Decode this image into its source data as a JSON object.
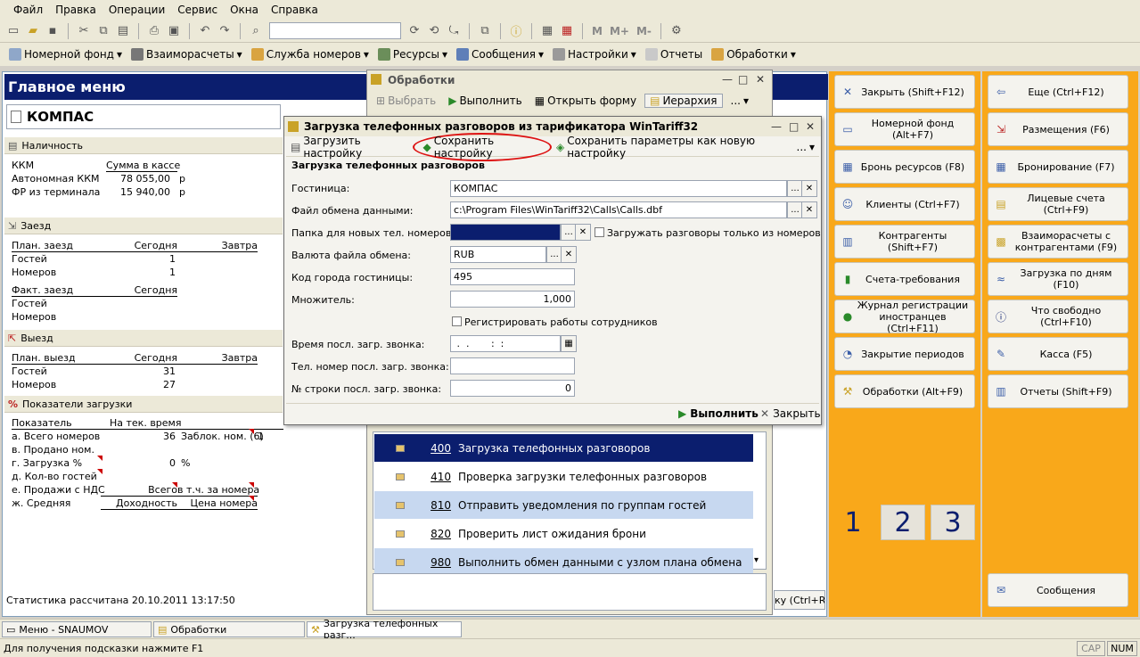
{
  "menubar": [
    "Файл",
    "Правка",
    "Операции",
    "Сервис",
    "Окна",
    "Справка"
  ],
  "toolbar2": [
    {
      "label": "Номерной фонд",
      "icon": "rooms-icon"
    },
    {
      "label": "Взаиморасчеты",
      "icon": "settlements-icon"
    },
    {
      "label": "Служба номеров",
      "icon": "room-service-icon"
    },
    {
      "label": "Ресурсы",
      "icon": "resources-icon"
    },
    {
      "label": "Сообщения",
      "icon": "messages-icon"
    },
    {
      "label": "Настройки",
      "icon": "settings-icon"
    },
    {
      "label": "Отчеты",
      "icon": "reports-icon"
    },
    {
      "label": "Обработки",
      "icon": "processing-icon"
    }
  ],
  "main_menu": {
    "title": "Главное меню",
    "company": "КОМПАС",
    "cash": {
      "header": "Наличность",
      "col1": "ККМ",
      "col2": "Сумма в кассе",
      "rows": [
        {
          "name": "Автономная ККМ",
          "value": "78 055,00",
          "unit": "р"
        },
        {
          "name": "ФР из терминала",
          "value": "15 940,00",
          "unit": "р"
        }
      ]
    },
    "checkin": {
      "header": "Заезд",
      "plan_label": "План. заезд",
      "today": "Сегодня",
      "tomorrow": "Завтра",
      "guests_label": "Гостей",
      "guests_today": "1",
      "rooms_label": "Номеров",
      "rooms_today": "1",
      "fact_label": "Факт. заезд",
      "fact_today": "Сегодня",
      "fact_guests": "Гостей",
      "fact_rooms": "Номеров"
    },
    "checkout": {
      "header": "Выезд",
      "plan_label": "План. выезд",
      "today": "Сегодня",
      "tomorrow": "Завтра",
      "guests_label": "Гостей",
      "guests_today": "31",
      "rooms_label": "Номеров",
      "rooms_today": "27"
    },
    "load": {
      "header": "Показатели загрузки",
      "col1": "Показатель",
      "col2": "На тек. время",
      "rows": [
        {
          "name": "а. Всего номеров",
          "value": "36",
          "extra": "Заблок. ном. (6)",
          "extra_value": "1"
        },
        {
          "name": "в. Продано ном.",
          "value": "",
          "extra": "",
          "extra_value": ""
        },
        {
          "name": "г. Загрузка %",
          "value": "0",
          "extra": "%",
          "extra_value": ""
        },
        {
          "name": "д. Кол-во гостей",
          "value": "",
          "extra": "",
          "extra_value": ""
        },
        {
          "name": "е. Продажи с НДС",
          "value": "Всего",
          "extra": "в т.ч. за номера",
          "extra_value": ""
        },
        {
          "name": "ж. Средняя",
          "value": "Доходность",
          "extra": "Цена номера",
          "extra_value": ""
        }
      ]
    },
    "footer": "Статистика рассчитана 20.10.2011 13:17:50"
  },
  "right_panel_1": [
    {
      "label": "Закрыть (Shift+F12)",
      "icon": "close-icon"
    },
    {
      "label": "Номерной фонд (Alt+F7)",
      "icon": "rooms-icon"
    },
    {
      "label": "Бронь ресурсов (F8)",
      "icon": "resources-booking-icon"
    },
    {
      "label": "Клиенты (Ctrl+F7)",
      "icon": "clients-icon"
    },
    {
      "label": "Контрагенты (Shift+F7)",
      "icon": "contractors-icon"
    },
    {
      "label": "Счета-требования",
      "icon": "invoices-icon"
    },
    {
      "label": "Журнал регистрации иностранцев (Ctrl+F11)",
      "icon": "foreigners-journal-icon"
    },
    {
      "label": "Закрытие периодов",
      "icon": "period-close-icon"
    },
    {
      "label": "Обработки (Alt+F9)",
      "icon": "processing-icon"
    }
  ],
  "right_panel_2": [
    {
      "label": "Еще (Ctrl+F12)",
      "icon": "more-icon"
    },
    {
      "label": "Размещения (F6)",
      "icon": "accommodation-icon"
    },
    {
      "label": "Бронирование (F7)",
      "icon": "booking-icon"
    },
    {
      "label": "Лицевые счета (Ctrl+F9)",
      "icon": "folio-icon"
    },
    {
      "label": "Взаиморасчеты с контрагентами (F9)",
      "icon": "settlements-icon"
    },
    {
      "label": "Загрузка по дням (F10)",
      "icon": "daily-load-icon"
    },
    {
      "label": "Что свободно (Ctrl+F10)",
      "icon": "info-icon"
    },
    {
      "label": "Касса (F5)",
      "icon": "cash-icon"
    },
    {
      "label": "Отчеты (Shift+F9)",
      "icon": "reports-icon"
    }
  ],
  "tabs": [
    "1",
    "2",
    "3"
  ],
  "messages_button": "Сообщения",
  "processing_window": {
    "title": "Обработки",
    "toolbar": {
      "select": "Выбрать",
      "run": "Выполнить",
      "open_form": "Открыть форму",
      "hierarchy": "Иерархия",
      "more": "..."
    },
    "partial_button": "ку (Ctrl+R)",
    "items": [
      {
        "code": "400",
        "name": "Загрузка телефонных разговоров"
      },
      {
        "code": "410",
        "name": "Проверка загрузки телефонных разговоров"
      },
      {
        "code": "810",
        "name": "Отправить уведомления по группам гостей"
      },
      {
        "code": "820",
        "name": "Проверить лист ожидания брони"
      },
      {
        "code": "980",
        "name": "Выполнить обмен данными с узлом плана обмена"
      }
    ]
  },
  "dialog": {
    "title": "Загрузка телефонных разговоров из тарификатора WinTariff32",
    "toolbar": {
      "load": "Загрузить настройку",
      "save": "Сохранить настройку",
      "save_new": "Сохранить параметры как новую настройку",
      "more": "..."
    },
    "subtitle": "Загрузка телефонных разговоров",
    "fields": {
      "hotel_label": "Гостиница:",
      "hotel": "КОМПАС",
      "file_label": "Файл обмена данными:",
      "file": "c:\\Program Files\\WinTariff32\\Calls\\Calls.dbf",
      "folder_label": "Папка для новых тел. номеров:",
      "folder": "",
      "only_from_numbers": "Загружать разговоры только из номеров",
      "currency_label": "Валюта файла обмена:",
      "currency": "RUB",
      "city_code_label": "Код города гостиницы:",
      "city_code": "495",
      "multiplier_label": "Множитель:",
      "multiplier": "1,000",
      "register_staff": "Регистрировать работы сотрудников",
      "last_time_label": "Время посл. загр. звонка:",
      "last_time": " .  .       :  :",
      "last_phone_label": "Тел. номер посл. загр. звонка:",
      "last_phone": "",
      "last_row_label": "№ строки посл. загр. звонка:",
      "last_row": "0"
    },
    "run": "Выполнить",
    "close": "Закрыть"
  },
  "taskbar": [
    "Меню - SNAUMOV",
    "Обработки",
    "Загрузка телефонных разг..."
  ],
  "statusbar": {
    "hint": "Для получения подсказки нажмите F1",
    "cap": "CAP",
    "num": "NUM"
  }
}
